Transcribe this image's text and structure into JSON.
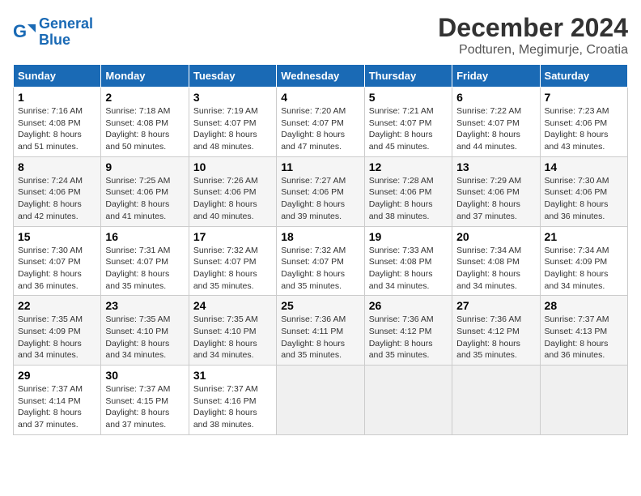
{
  "logo": {
    "line1": "General",
    "line2": "Blue"
  },
  "title": "December 2024",
  "location": "Podturen, Megimurje, Croatia",
  "days_of_week": [
    "Sunday",
    "Monday",
    "Tuesday",
    "Wednesday",
    "Thursday",
    "Friday",
    "Saturday"
  ],
  "weeks": [
    [
      {
        "day": "1",
        "sunrise": "7:16 AM",
        "sunset": "4:08 PM",
        "daylight": "8 hours and 51 minutes."
      },
      {
        "day": "2",
        "sunrise": "7:18 AM",
        "sunset": "4:08 PM",
        "daylight": "8 hours and 50 minutes."
      },
      {
        "day": "3",
        "sunrise": "7:19 AM",
        "sunset": "4:07 PM",
        "daylight": "8 hours and 48 minutes."
      },
      {
        "day": "4",
        "sunrise": "7:20 AM",
        "sunset": "4:07 PM",
        "daylight": "8 hours and 47 minutes."
      },
      {
        "day": "5",
        "sunrise": "7:21 AM",
        "sunset": "4:07 PM",
        "daylight": "8 hours and 45 minutes."
      },
      {
        "day": "6",
        "sunrise": "7:22 AM",
        "sunset": "4:07 PM",
        "daylight": "8 hours and 44 minutes."
      },
      {
        "day": "7",
        "sunrise": "7:23 AM",
        "sunset": "4:06 PM",
        "daylight": "8 hours and 43 minutes."
      }
    ],
    [
      {
        "day": "8",
        "sunrise": "7:24 AM",
        "sunset": "4:06 PM",
        "daylight": "8 hours and 42 minutes."
      },
      {
        "day": "9",
        "sunrise": "7:25 AM",
        "sunset": "4:06 PM",
        "daylight": "8 hours and 41 minutes."
      },
      {
        "day": "10",
        "sunrise": "7:26 AM",
        "sunset": "4:06 PM",
        "daylight": "8 hours and 40 minutes."
      },
      {
        "day": "11",
        "sunrise": "7:27 AM",
        "sunset": "4:06 PM",
        "daylight": "8 hours and 39 minutes."
      },
      {
        "day": "12",
        "sunrise": "7:28 AM",
        "sunset": "4:06 PM",
        "daylight": "8 hours and 38 minutes."
      },
      {
        "day": "13",
        "sunrise": "7:29 AM",
        "sunset": "4:06 PM",
        "daylight": "8 hours and 37 minutes."
      },
      {
        "day": "14",
        "sunrise": "7:30 AM",
        "sunset": "4:06 PM",
        "daylight": "8 hours and 36 minutes."
      }
    ],
    [
      {
        "day": "15",
        "sunrise": "7:30 AM",
        "sunset": "4:07 PM",
        "daylight": "8 hours and 36 minutes."
      },
      {
        "day": "16",
        "sunrise": "7:31 AM",
        "sunset": "4:07 PM",
        "daylight": "8 hours and 35 minutes."
      },
      {
        "day": "17",
        "sunrise": "7:32 AM",
        "sunset": "4:07 PM",
        "daylight": "8 hours and 35 minutes."
      },
      {
        "day": "18",
        "sunrise": "7:32 AM",
        "sunset": "4:07 PM",
        "daylight": "8 hours and 35 minutes."
      },
      {
        "day": "19",
        "sunrise": "7:33 AM",
        "sunset": "4:08 PM",
        "daylight": "8 hours and 34 minutes."
      },
      {
        "day": "20",
        "sunrise": "7:34 AM",
        "sunset": "4:08 PM",
        "daylight": "8 hours and 34 minutes."
      },
      {
        "day": "21",
        "sunrise": "7:34 AM",
        "sunset": "4:09 PM",
        "daylight": "8 hours and 34 minutes."
      }
    ],
    [
      {
        "day": "22",
        "sunrise": "7:35 AM",
        "sunset": "4:09 PM",
        "daylight": "8 hours and 34 minutes."
      },
      {
        "day": "23",
        "sunrise": "7:35 AM",
        "sunset": "4:10 PM",
        "daylight": "8 hours and 34 minutes."
      },
      {
        "day": "24",
        "sunrise": "7:35 AM",
        "sunset": "4:10 PM",
        "daylight": "8 hours and 34 minutes."
      },
      {
        "day": "25",
        "sunrise": "7:36 AM",
        "sunset": "4:11 PM",
        "daylight": "8 hours and 35 minutes."
      },
      {
        "day": "26",
        "sunrise": "7:36 AM",
        "sunset": "4:12 PM",
        "daylight": "8 hours and 35 minutes."
      },
      {
        "day": "27",
        "sunrise": "7:36 AM",
        "sunset": "4:12 PM",
        "daylight": "8 hours and 35 minutes."
      },
      {
        "day": "28",
        "sunrise": "7:37 AM",
        "sunset": "4:13 PM",
        "daylight": "8 hours and 36 minutes."
      }
    ],
    [
      {
        "day": "29",
        "sunrise": "7:37 AM",
        "sunset": "4:14 PM",
        "daylight": "8 hours and 37 minutes."
      },
      {
        "day": "30",
        "sunrise": "7:37 AM",
        "sunset": "4:15 PM",
        "daylight": "8 hours and 37 minutes."
      },
      {
        "day": "31",
        "sunrise": "7:37 AM",
        "sunset": "4:16 PM",
        "daylight": "8 hours and 38 minutes."
      },
      null,
      null,
      null,
      null
    ]
  ]
}
